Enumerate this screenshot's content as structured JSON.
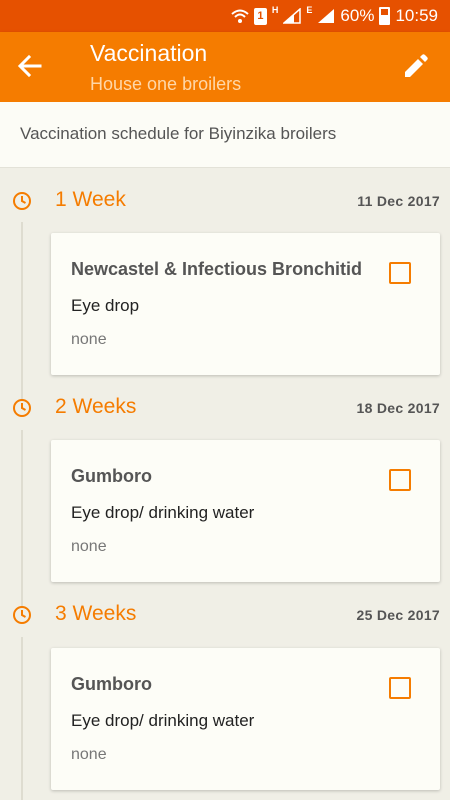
{
  "status_bar": {
    "battery": "60%",
    "time": "10:59",
    "sim": "1",
    "net_h": "H",
    "net_e": "E"
  },
  "app_bar": {
    "title": "Vaccination",
    "subtitle": "House one broilers"
  },
  "header": {
    "description": "Vaccination schedule for Biyinzika broilers"
  },
  "schedule": [
    {
      "week": "1 Week",
      "date": "11 Dec 2017",
      "vaccine": "Newcastel & Infectious Bronchitid",
      "method": "Eye drop",
      "note": "none",
      "done": false
    },
    {
      "week": "2 Weeks",
      "date": "18 Dec 2017",
      "vaccine": "Gumboro",
      "method": "Eye drop/ drinking water",
      "note": "none",
      "done": false
    },
    {
      "week": "3 Weeks",
      "date": "25 Dec 2017",
      "vaccine": "Gumboro",
      "method": "Eye drop/ drinking water",
      "note": "none",
      "done": false
    }
  ],
  "colors": {
    "accent": "#f57c00",
    "status_bar": "#e65100"
  }
}
